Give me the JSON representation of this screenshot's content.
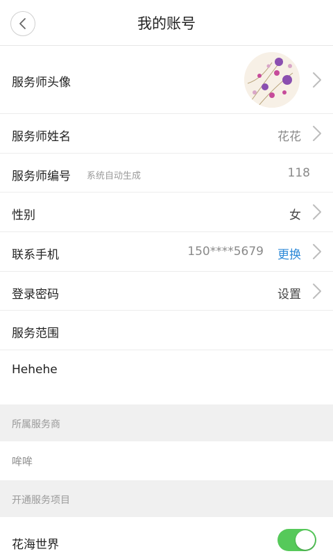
{
  "header": {
    "title": "我的账号"
  },
  "profile": {
    "avatar_label": "服务师头像",
    "name_label": "服务师姓名",
    "name_value": "花花",
    "number_label": "服务师编号",
    "number_hint": "系统自动生成",
    "number_value": "118",
    "gender_label": "性别",
    "gender_value": "女",
    "phone_label": "联系手机",
    "phone_value": "150****5679",
    "phone_action": "更换",
    "password_label": "登录密码",
    "password_value": "设置",
    "scope_label": "服务范围",
    "scope_value": "Hehehe"
  },
  "provider": {
    "section_title": "所属服务商",
    "value": "哞哞"
  },
  "services": {
    "section_title": "开通服务项目",
    "items": [
      {
        "label": "花海世界",
        "enabled": true
      }
    ]
  },
  "colors": {
    "accent_blue": "#2e8ad8",
    "toggle_on": "#56c95a"
  }
}
